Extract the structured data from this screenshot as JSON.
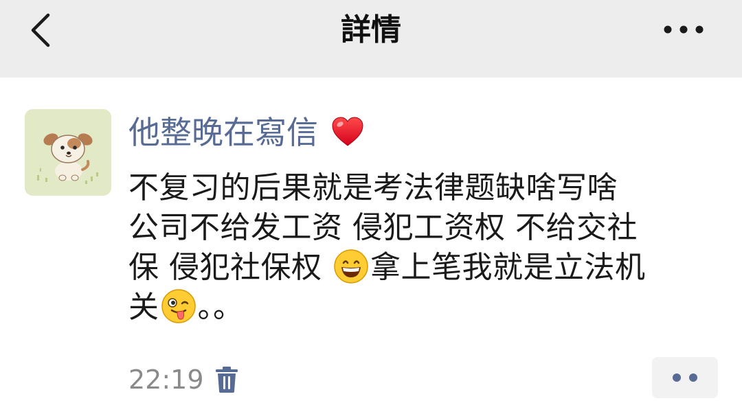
{
  "header": {
    "title": "詳情",
    "back_icon": "chevron-left-icon",
    "more_icon": "more-dots-icon"
  },
  "post": {
    "author": "他整晚在寫信",
    "author_color": "#576b95",
    "author_badge_icon": "red-heart-icon",
    "text_line1": "不复习的后果就是考法律题缺啥写啥",
    "text_line2": "公司不给发工资 侵犯工资权 不给交社",
    "text_line3a": "保 侵犯社保权 ",
    "text_line3b": "拿上笔我就是立法机",
    "text_line4a": "关",
    "text_line4b": "。。",
    "emoji_1": "grinning-face-icon",
    "emoji_2": "winking-tongue-face-icon",
    "timestamp": "22:19",
    "delete_icon": "trash-icon",
    "action_icon": "more-dots-icon"
  }
}
